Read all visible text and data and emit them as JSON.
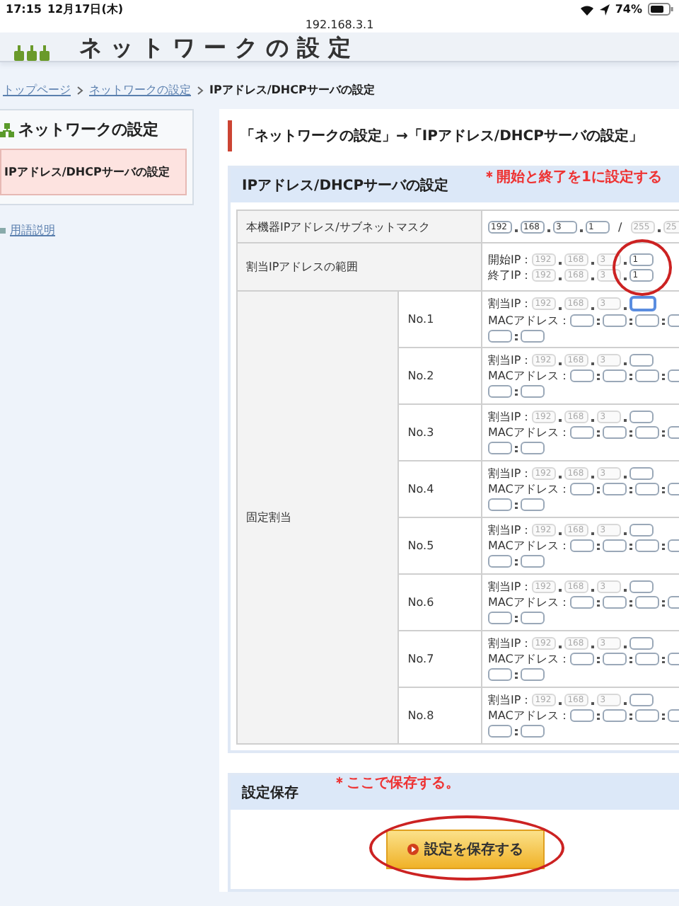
{
  "status_bar": {
    "time": "17:15",
    "date": "12月17日(木)",
    "battery": "74%",
    "url": "192.168.3.1"
  },
  "header": {
    "title": "ネットワークの設定"
  },
  "breadcrumb": {
    "links": [
      "トップページ",
      "ネットワークの設定"
    ],
    "current": "IPアドレス/DHCPサーバの設定"
  },
  "sidebar": {
    "heading": "ネットワークの設定",
    "items": [
      {
        "label": "IPアドレス/DHCPサーバの設定",
        "selected": true
      }
    ],
    "links": [
      "用語説明"
    ]
  },
  "main": {
    "heading": "「ネットワークの設定」→「IPアドレス/DHCPサーバの設定」",
    "panel": {
      "title": "IPアドレス/DHCPサーバの設定",
      "note": "＊開始と終了を1に設定する",
      "device_row": {
        "label": "本機器IPアドレス/サブネットマスク",
        "ip": [
          "192",
          "168",
          "3",
          "1"
        ],
        "separator": "/",
        "mask": [
          "255",
          "25"
        ]
      },
      "range_row": {
        "label": "割当IPアドレスの範囲",
        "lines": [
          {
            "label": "開始IP：",
            "prefix": [
              "192",
              "168",
              "3"
            ],
            "value": "1"
          },
          {
            "label": "終了IP：",
            "prefix": [
              "192",
              "168",
              "3"
            ],
            "value": "1"
          }
        ]
      },
      "fixed": {
        "label": "固定割当",
        "entries": [
          {
            "no": "No.1",
            "ip_label": "割当IP：",
            "mac_label": "MACアドレス：",
            "prefix": [
              "192",
              "168",
              "3"
            ],
            "focused": true
          },
          {
            "no": "No.2",
            "ip_label": "割当IP：",
            "mac_label": "MACアドレス：",
            "prefix": [
              "192",
              "168",
              "3"
            ],
            "focused": false
          },
          {
            "no": "No.3",
            "ip_label": "割当IP：",
            "mac_label": "MACアドレス：",
            "prefix": [
              "192",
              "168",
              "3"
            ],
            "focused": false
          },
          {
            "no": "No.4",
            "ip_label": "割当IP：",
            "mac_label": "MACアドレス：",
            "prefix": [
              "192",
              "168",
              "3"
            ],
            "focused": false
          },
          {
            "no": "No.5",
            "ip_label": "割当IP：",
            "mac_label": "MACアドレス：",
            "prefix": [
              "192",
              "168",
              "3"
            ],
            "focused": false
          },
          {
            "no": "No.6",
            "ip_label": "割当IP：",
            "mac_label": "MACアドレス：",
            "prefix": [
              "192",
              "168",
              "3"
            ],
            "focused": false
          },
          {
            "no": "No.7",
            "ip_label": "割当IP：",
            "mac_label": "MACアドレス：",
            "prefix": [
              "192",
              "168",
              "3"
            ],
            "focused": false
          },
          {
            "no": "No.8",
            "ip_label": "割当IP：",
            "mac_label": "MACアドレス：",
            "prefix": [
              "192",
              "168",
              "3"
            ],
            "focused": false
          }
        ]
      }
    },
    "save": {
      "title": "設定保存",
      "note": "＊ここで保存する。",
      "button": "設定を保存する"
    }
  }
}
